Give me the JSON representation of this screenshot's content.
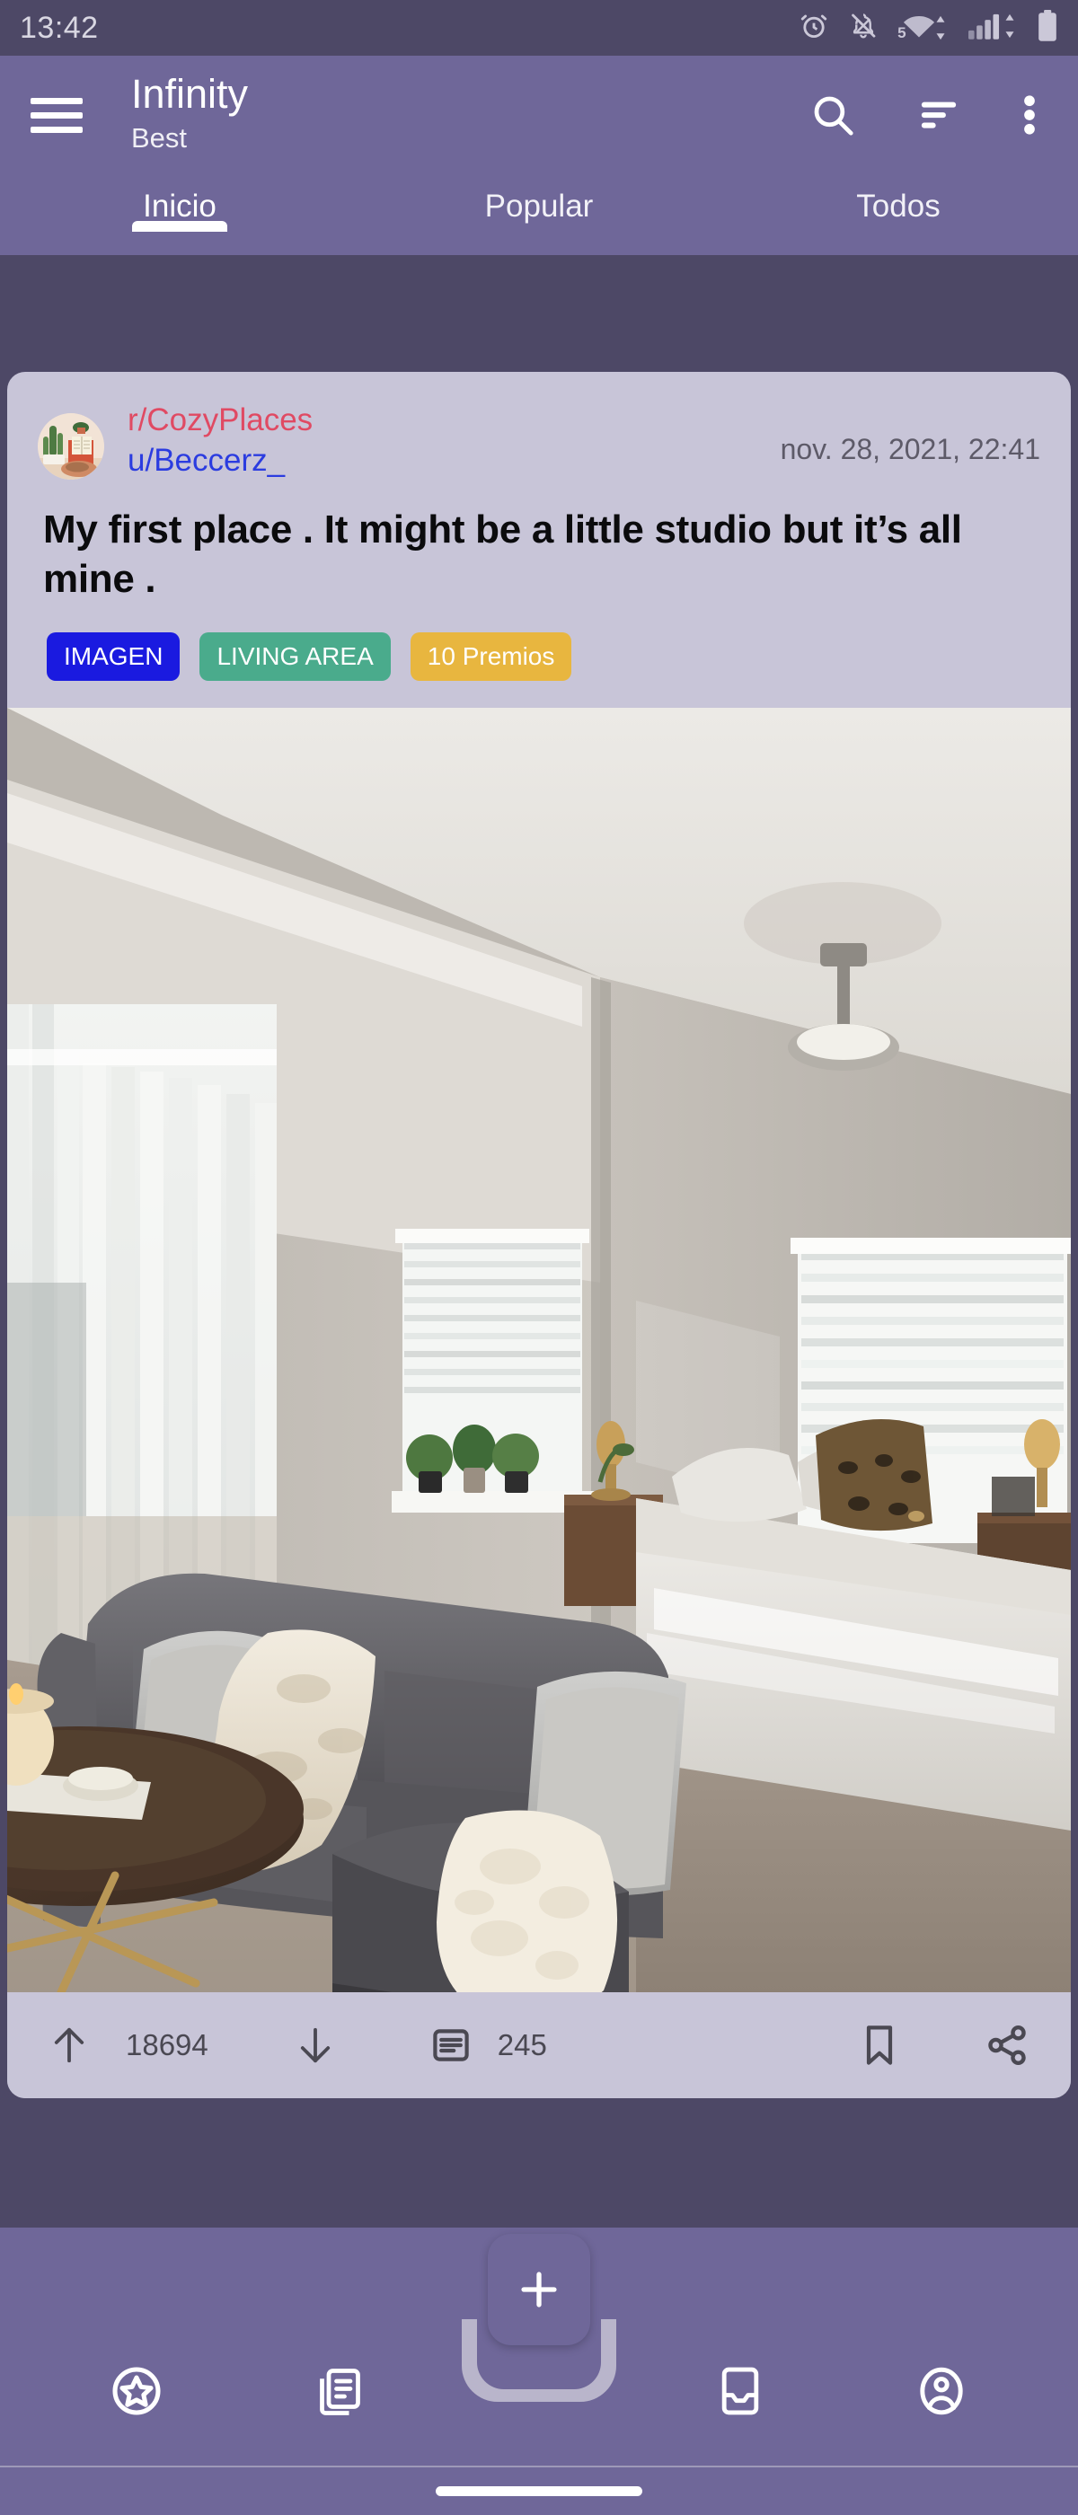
{
  "status_bar": {
    "time": "13:42",
    "wifi_label": "5",
    "icons": [
      "alarm-clock-icon",
      "bell-muted-icon",
      "wifi-icon",
      "cellular-signal-icon",
      "battery-icon"
    ]
  },
  "app_bar": {
    "menu_icon": "hamburger-menu-icon",
    "title": "Infinity",
    "subtitle": "Best",
    "actions": [
      {
        "name": "search-icon",
        "label": "Search"
      },
      {
        "name": "sort-icon",
        "label": "Sort"
      },
      {
        "name": "overflow-menu-icon",
        "label": "More options"
      }
    ]
  },
  "tabs": {
    "items": [
      {
        "label": "Inicio",
        "active": true
      },
      {
        "label": "Popular",
        "active": false
      },
      {
        "label": "Todos",
        "active": false
      }
    ]
  },
  "post": {
    "subreddit": "r/CozyPlaces",
    "author": "u/Beccerz_",
    "timestamp": "nov. 28, 2021, 22:41",
    "title": "My first place . It might be a little studio but it’s all mine .",
    "avatar_name": "subreddit-avatar",
    "badges": [
      {
        "label": "IMAGEN",
        "color": "#1a1ae0"
      },
      {
        "label": "LIVING AREA",
        "color": "#4aab8c"
      },
      {
        "label": "10 Premios",
        "color": "#e8b63f"
      }
    ],
    "image_alt": "studio apartment living area with gray sectional sofa and bed",
    "actions": {
      "upvote_icon": "upvote-arrow-icon",
      "score": "18694",
      "downvote_icon": "downvote-arrow-icon",
      "comment_icon": "comment-icon",
      "comment_count": "245",
      "save_icon": "bookmark-icon",
      "share_icon": "share-icon"
    }
  },
  "fab": {
    "label": "+",
    "name": "create-post-fab"
  },
  "bottom_nav": {
    "items": [
      {
        "name": "nav-item-awards",
        "icon": "star-badge-icon"
      },
      {
        "name": "nav-item-posts",
        "icon": "multi-post-icon"
      },
      {
        "name": "nav-item-inbox",
        "icon": "inbox-icon"
      },
      {
        "name": "nav-item-profile",
        "icon": "account-circle-icon"
      }
    ]
  },
  "colors": {
    "status_bar_bg": "#4d4866",
    "app_bar_bg": "#6f6799",
    "card_bg": "#c8c5d8",
    "accent_subreddit": "#e04a63",
    "accent_user": "#2b3ce0"
  }
}
